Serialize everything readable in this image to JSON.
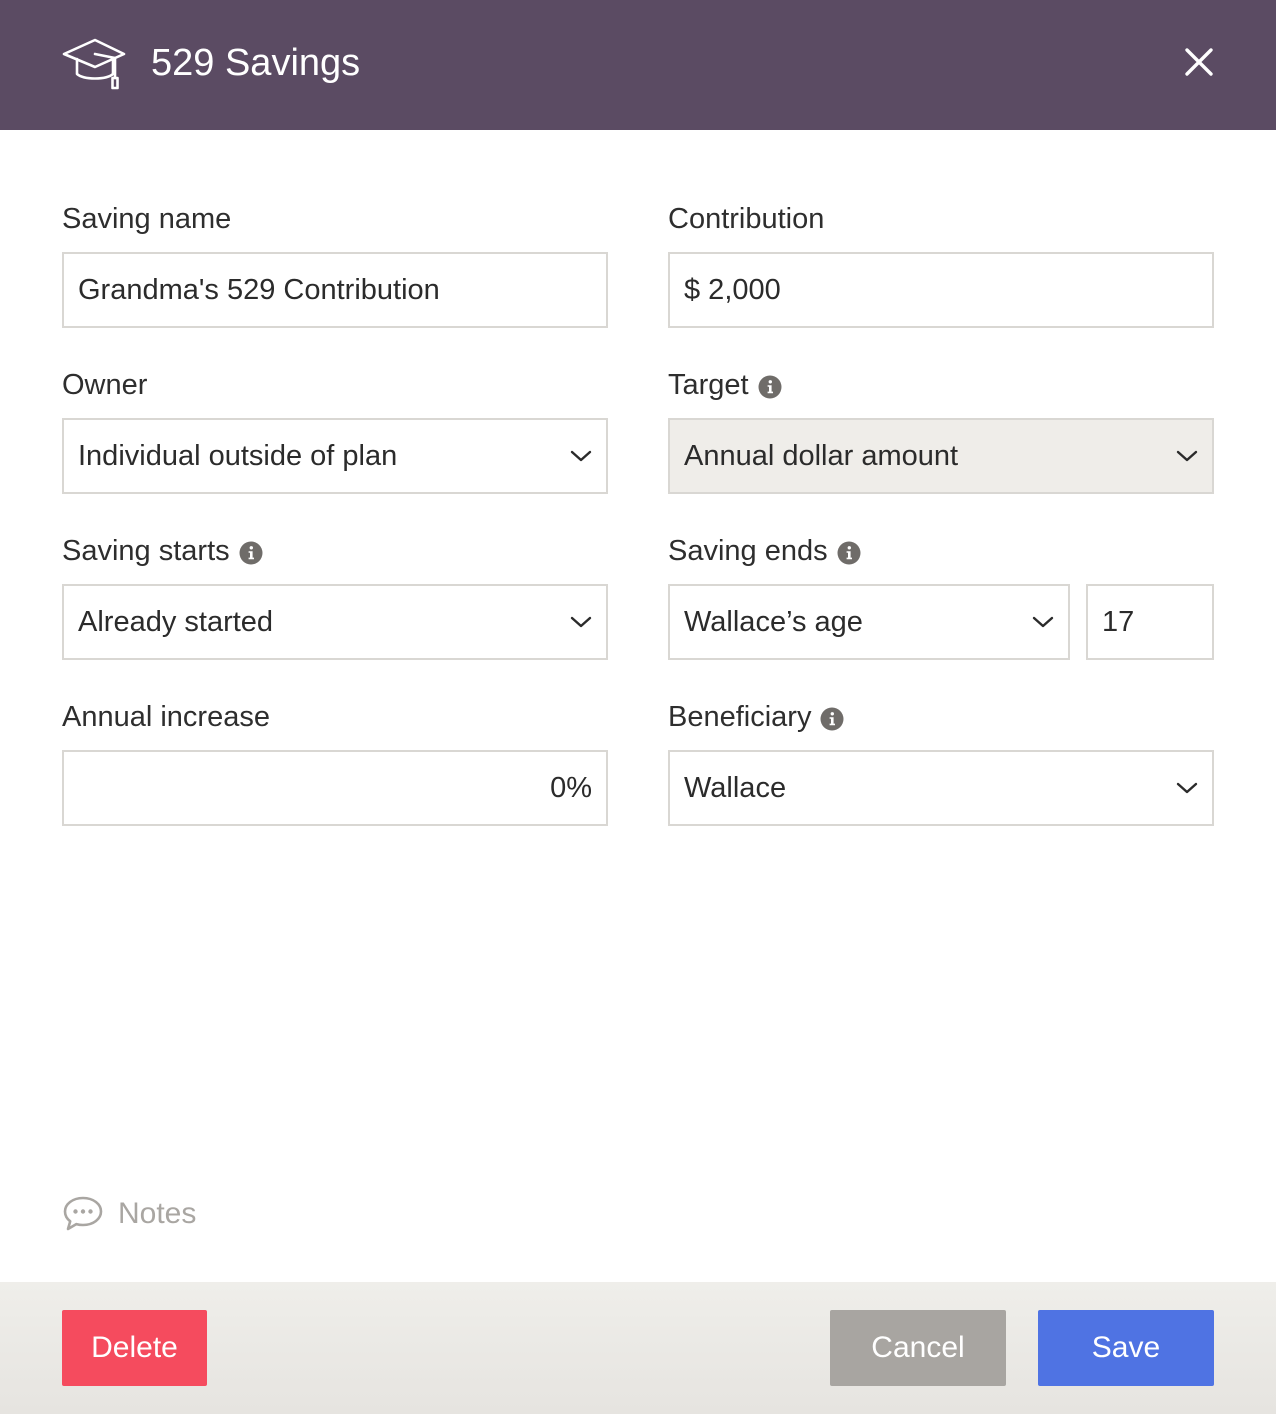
{
  "header": {
    "title": "529 Savings",
    "icon": "graduation-cap-icon",
    "close_icon": "close-icon"
  },
  "fields": {
    "saving_name": {
      "label": "Saving name",
      "value": "Grandma's 529 Contribution"
    },
    "contribution": {
      "label": "Contribution",
      "value": "$ 2,000"
    },
    "owner": {
      "label": "Owner",
      "value": "Individual outside of plan"
    },
    "target": {
      "label": "Target",
      "value": "Annual dollar amount"
    },
    "saving_starts": {
      "label": "Saving starts",
      "value": "Already started"
    },
    "saving_ends": {
      "label": "Saving ends",
      "value": "Wallace’s age",
      "age_value": "17"
    },
    "annual_increase": {
      "label": "Annual increase",
      "value": "0%"
    },
    "beneficiary": {
      "label": "Beneficiary",
      "value": "Wallace"
    }
  },
  "notes": {
    "label": "Notes"
  },
  "footer": {
    "delete_label": "Delete",
    "cancel_label": "Cancel",
    "save_label": "Save"
  },
  "colors": {
    "header_bg": "#5b4b63",
    "delete": "#f54b5e",
    "cancel": "#a8a5a1",
    "save": "#4f73e3",
    "footer_bg": "#efeeea"
  }
}
